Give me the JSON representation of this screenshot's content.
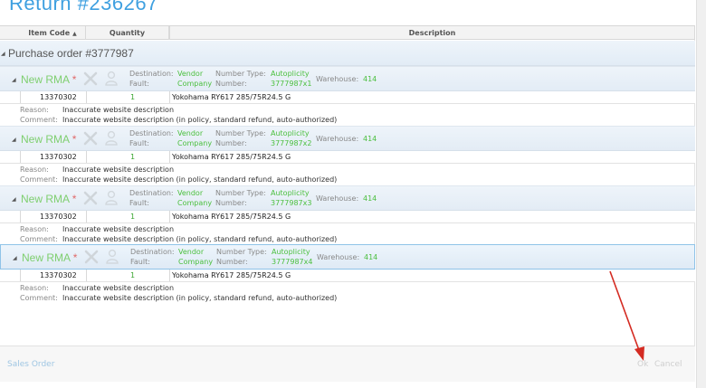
{
  "page": {
    "title": "Return #236267"
  },
  "columns": [
    {
      "label": "Item Code",
      "sorted": "ascending"
    },
    {
      "label": "Quantity"
    },
    {
      "label": "Description"
    }
  ],
  "purchase_order": {
    "label": "Purchase order #3777987"
  },
  "rma_labels": {
    "title": "New RMA",
    "required_mark": "*",
    "destination": "Destination:",
    "fault": "Fault:",
    "number_type": "Number Type:",
    "number": "Number:",
    "warehouse": "Warehouse:",
    "reason": "Reason:",
    "comment": "Comment:"
  },
  "rmas": [
    {
      "destination": "Vendor",
      "fault": "Company",
      "number_type": "Autoplicity",
      "number": "3777987x1",
      "warehouse": "414",
      "item_code": "13370302",
      "quantity": "1",
      "description": "Yokohama RY617 285/75R24.5 G",
      "reason": "Inaccurate website description",
      "comment": "Inaccurate website description (in policy, standard refund, auto-authorized)"
    },
    {
      "destination": "Vendor",
      "fault": "Company",
      "number_type": "Autoplicity",
      "number": "3777987x2",
      "warehouse": "414",
      "item_code": "13370302",
      "quantity": "1",
      "description": "Yokohama RY617 285/75R24.5 G",
      "reason": "Inaccurate website description",
      "comment": "Inaccurate website description (in policy, standard refund, auto-authorized)"
    },
    {
      "destination": "Vendor",
      "fault": "Company",
      "number_type": "Autoplicity",
      "number": "3777987x3",
      "warehouse": "414",
      "item_code": "13370302",
      "quantity": "1",
      "description": "Yokohama RY617 285/75R24.5 G",
      "reason": "Inaccurate website description",
      "comment": "Inaccurate website description (in policy, standard refund, auto-authorized)"
    },
    {
      "destination": "Vendor",
      "fault": "Company",
      "number_type": "Autoplicity",
      "number": "3777987x4",
      "warehouse": "414",
      "item_code": "13370302",
      "quantity": "1",
      "description": "Yokohama RY617 285/75R24.5 G",
      "reason": "Inaccurate website description",
      "comment": "Inaccurate website description (in policy, standard refund, auto-authorized)"
    }
  ],
  "footer": {
    "sales_order_link": "Sales Order",
    "ok_label": "Ok",
    "cancel_label": "Cancel"
  },
  "colors": {
    "accent": "#3fa0e0",
    "rma_green": "#7fcf6f",
    "value_green": "#4bbf3e",
    "required_red": "#e06a6a",
    "annotation_red": "#d42b22"
  }
}
